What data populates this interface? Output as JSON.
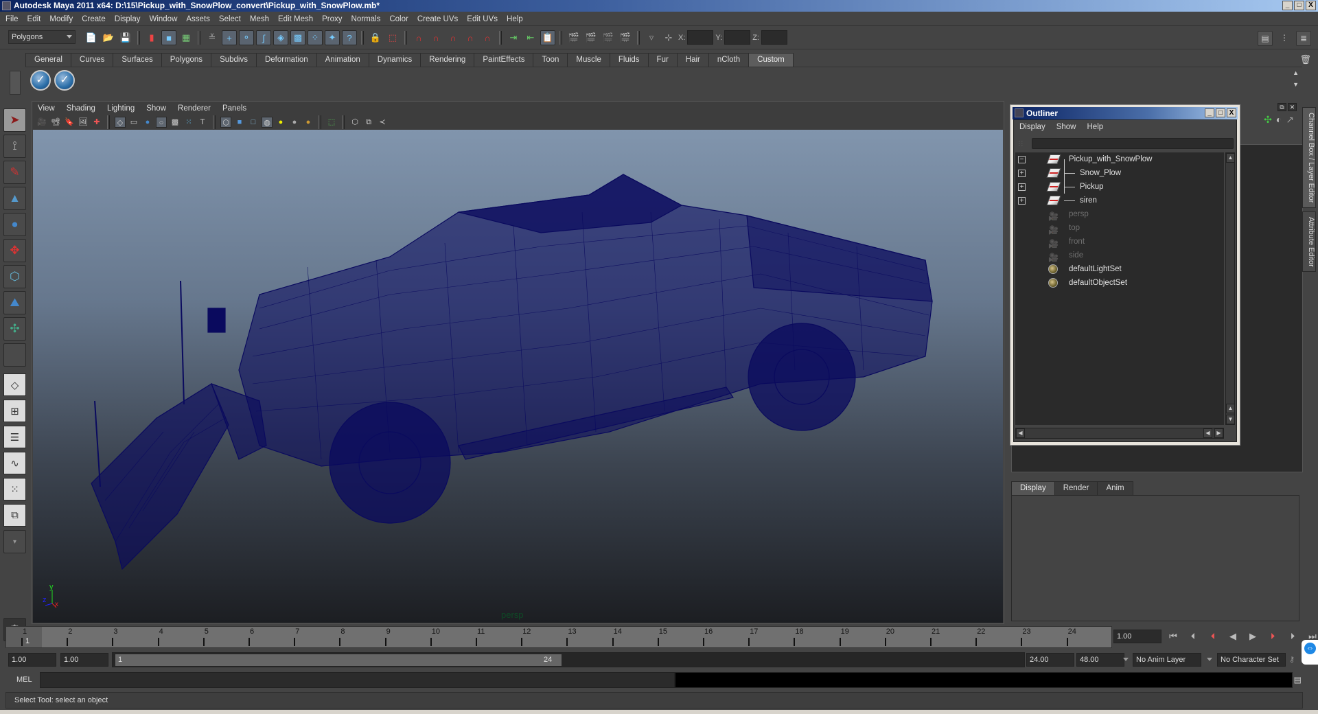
{
  "window": {
    "title": "Autodesk Maya 2011 x64: D:\\15\\Pickup_with_SnowPlow_convert\\Pickup_with_SnowPlow.mb*",
    "controls": [
      "_",
      "□",
      "X"
    ]
  },
  "menubar": [
    "File",
    "Edit",
    "Modify",
    "Create",
    "Display",
    "Window",
    "Assets",
    "Select",
    "Mesh",
    "Edit Mesh",
    "Proxy",
    "Normals",
    "Color",
    "Create UVs",
    "Edit UVs",
    "Help"
  ],
  "statusline": {
    "mode": "Polygons",
    "x_label": "X:",
    "y_label": "Y:",
    "z_label": "Z:",
    "x_value": "",
    "y_value": "",
    "z_value": ""
  },
  "shelf": {
    "tabs": [
      "General",
      "Curves",
      "Surfaces",
      "Polygons",
      "Subdivs",
      "Deformation",
      "Animation",
      "Dynamics",
      "Rendering",
      "PaintEffects",
      "Toon",
      "Muscle",
      "Fluids",
      "Fur",
      "Hair",
      "nCloth",
      "Custom"
    ],
    "active_tab": "Custom",
    "buttons": [
      "check-button-1",
      "check-button-2"
    ]
  },
  "toolbox": {
    "tools": [
      "select-tool",
      "lasso-tool",
      "paint-select-tool",
      "move-tool",
      "rotate-tool",
      "scale-tool",
      "universal-manipulator",
      "soft-modification-tool",
      "show-manipulator-tool",
      "last-used-tool"
    ],
    "active": "select-tool",
    "layouts": [
      "single-perspective-layout",
      "four-view-layout",
      "outliner-persp-layout",
      "persp-graph-layout",
      "hypershade-persp-layout",
      "persp-graph-hypergraph-layout"
    ]
  },
  "viewport": {
    "menus": [
      "View",
      "Shading",
      "Lighting",
      "Show",
      "Renderer",
      "Panels"
    ],
    "camera_label": "persp",
    "axis": {
      "x": "x",
      "y": "y",
      "z": "z"
    },
    "colors": {
      "wireframe": "#0a0a5e",
      "bg_top": "#8195ad",
      "bg_bottom": "#1c1e22"
    }
  },
  "outliner": {
    "title": "Outliner",
    "menus": [
      "Display",
      "Show",
      "Help"
    ],
    "filter_value": "",
    "items": [
      {
        "label": "Pickup_with_SnowPlow",
        "type": "transform",
        "expander": "minus",
        "dim": false,
        "level": 0
      },
      {
        "label": "Snow_Plow",
        "type": "transform",
        "expander": "plus",
        "dim": false,
        "level": 1
      },
      {
        "label": "Pickup",
        "type": "transform",
        "expander": "plus",
        "dim": false,
        "level": 1
      },
      {
        "label": "siren",
        "type": "transform",
        "expander": "plus",
        "dim": false,
        "level": 1
      },
      {
        "label": "persp",
        "type": "camera",
        "expander": "",
        "dim": true,
        "level": 0
      },
      {
        "label": "top",
        "type": "camera",
        "expander": "",
        "dim": true,
        "level": 0
      },
      {
        "label": "front",
        "type": "camera",
        "expander": "",
        "dim": true,
        "level": 0
      },
      {
        "label": "side",
        "type": "camera",
        "expander": "",
        "dim": true,
        "level": 0
      },
      {
        "label": "defaultLightSet",
        "type": "set",
        "expander": "",
        "dim": false,
        "level": 0
      },
      {
        "label": "defaultObjectSet",
        "type": "set",
        "expander": "",
        "dim": false,
        "level": 0
      }
    ]
  },
  "channel_box": {
    "side_tabs": [
      "Channel Box / Layer Editor",
      "Attribute Editor"
    ],
    "layer_tabs": [
      "Display",
      "Render",
      "Anim"
    ],
    "active_layer_tab": "Display"
  },
  "timeline": {
    "frames": [
      "1",
      "2",
      "3",
      "4",
      "5",
      "6",
      "7",
      "8",
      "9",
      "10",
      "11",
      "12",
      "13",
      "14",
      "15",
      "16",
      "17",
      "18",
      "19",
      "20",
      "21",
      "22",
      "23",
      "24"
    ],
    "current_frame": "1",
    "current_time": "1.00",
    "playback_buttons": [
      "go-to-start",
      "step-back-frame",
      "step-back-key",
      "play-backwards",
      "play-forwards",
      "step-forward-key",
      "step-forward-frame",
      "go-to-end"
    ]
  },
  "range": {
    "start_time": "1.00",
    "playback_start": "1.00",
    "slider_start": "1",
    "slider_end": "24",
    "playback_end": "24.00",
    "end_time": "48.00",
    "anim_layer": "No Anim Layer",
    "character_set": "No Character Set"
  },
  "command_line": {
    "label": "MEL",
    "value": ""
  },
  "help_line": "Select Tool: select an object"
}
